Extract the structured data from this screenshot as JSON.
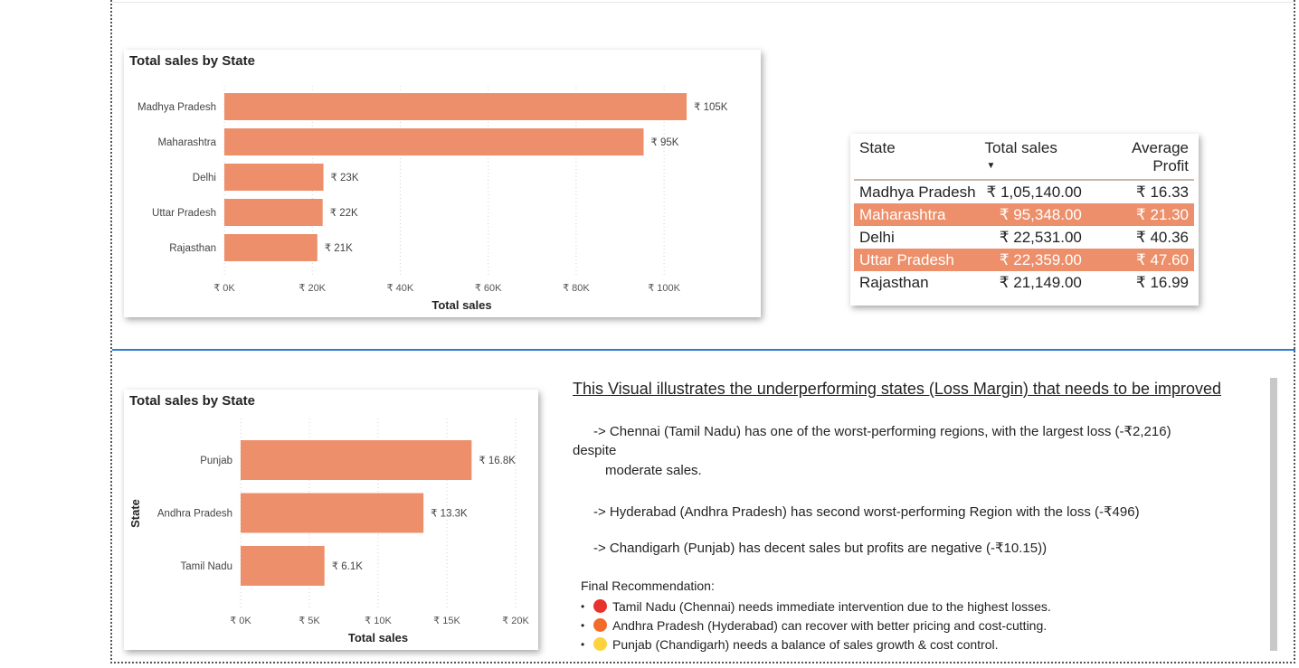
{
  "chart_data": [
    {
      "type": "bar",
      "orientation": "horizontal",
      "title": "Total sales by State",
      "xlabel": "Total sales",
      "ylabel": "",
      "categories": [
        "Madhya Pradesh",
        "Maharashtra",
        "Delhi",
        "Uttar Pradesh",
        "Rajasthan"
      ],
      "values": [
        105140,
        95348,
        22531,
        22359,
        21149
      ],
      "data_labels": [
        "₹ 105K",
        "₹ 95K",
        "₹ 23K",
        "₹ 22K",
        "₹ 21K"
      ],
      "xticks": [
        0,
        20000,
        40000,
        60000,
        80000,
        100000
      ],
      "xtick_labels": [
        "₹ 0K",
        "₹ 20K",
        "₹ 40K",
        "₹ 60K",
        "₹ 80K",
        "₹ 100K"
      ],
      "xlim": [
        0,
        108000
      ],
      "grid": true,
      "bar_color": "#ec8f6a"
    },
    {
      "type": "bar",
      "orientation": "horizontal",
      "title": "Total sales by State",
      "xlabel": "Total sales",
      "ylabel": "State",
      "categories": [
        "Punjab",
        "Andhra Pradesh",
        "Tamil Nadu"
      ],
      "values": [
        16800,
        13300,
        6100
      ],
      "data_labels": [
        "₹ 16.8K",
        "₹ 13.3K",
        "₹ 6.1K"
      ],
      "xticks": [
        0,
        5000,
        10000,
        15000,
        20000
      ],
      "xtick_labels": [
        "₹ 0K",
        "₹ 5K",
        "₹ 10K",
        "₹ 15K",
        "₹ 20K"
      ],
      "xlim": [
        0,
        20000
      ],
      "grid": true,
      "bar_color": "#ec8f6a"
    }
  ],
  "table": {
    "headers": [
      "State",
      "Total sales",
      "Average Profit"
    ],
    "sort_indicator": "▼",
    "rows": [
      {
        "state": "Madhya Pradesh",
        "sales": "₹ 1,05,140.00",
        "profit": "₹ 16.33"
      },
      {
        "state": "Maharashtra",
        "sales": "₹ 95,348.00",
        "profit": "₹ 21.30"
      },
      {
        "state": "Delhi",
        "sales": "₹ 22,531.00",
        "profit": "₹ 40.36"
      },
      {
        "state": "Uttar Pradesh",
        "sales": "₹ 22,359.00",
        "profit": "₹ 47.60"
      },
      {
        "state": "Rajasthan",
        "sales": "₹ 21,149.00",
        "profit": "₹ 16.99"
      }
    ],
    "highlight_color": "#ec8f6a"
  },
  "notes": {
    "title": "This Visual illustrates the underperforming states (Loss Margin) that needs to be improved",
    "line1a": "-> Chennai (Tamil Nadu) has one of the worst-performing regions, with the largest loss (-₹2,216)",
    "line1b": "despite",
    "line1c": "moderate sales.",
    "line2": "-> Hyderabad (Andhra Pradesh) has second worst-performing Region with the loss (-₹496)",
    "line3": "-> Chandigarh (Punjab) has decent sales but profits are negative (-₹10.15))",
    "rec_title": "Final Recommendation:",
    "recs": [
      {
        "text": "Tamil Nadu (Chennai) needs immediate intervention due to the highest losses.",
        "color": "#e8322e"
      },
      {
        "text": "Andhra Pradesh (Hyderabad) can recover with better pricing and cost-cutting.",
        "color": "#f26a2c"
      },
      {
        "text": "Punjab (Chandigarh) needs a balance of sales growth & cost control.",
        "color": "#fbd33c"
      }
    ]
  }
}
